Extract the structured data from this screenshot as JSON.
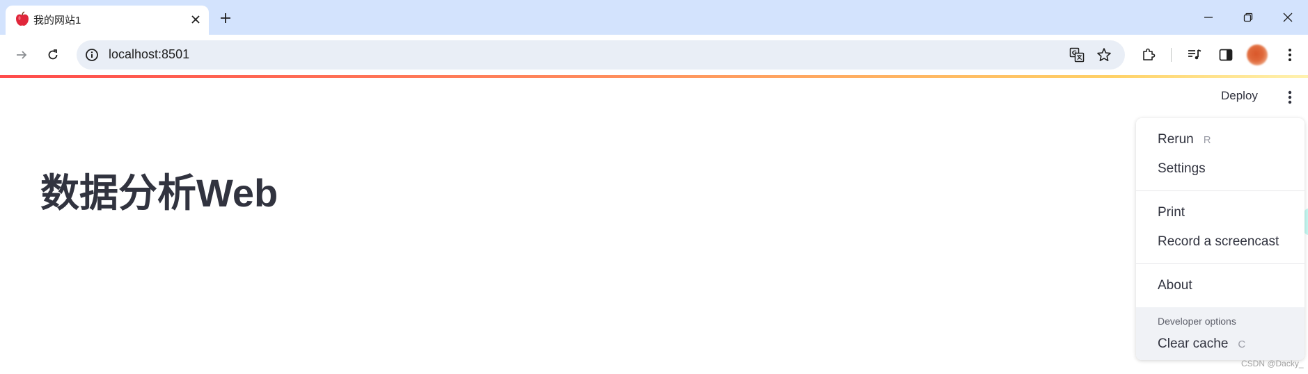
{
  "browser": {
    "tab": {
      "title": "我的网站1",
      "favicon": "apple-icon"
    },
    "address": {
      "url": "localhost:8501"
    }
  },
  "app": {
    "header": {
      "deploy_label": "Deploy"
    },
    "title": "数据分析Web"
  },
  "menu": {
    "items": [
      {
        "label": "Rerun",
        "shortcut": "R"
      },
      {
        "label": "Settings"
      },
      {
        "label": "Print"
      },
      {
        "label": "Record a screencast"
      },
      {
        "label": "About"
      }
    ],
    "developer": {
      "section_label": "Developer options",
      "items": [
        {
          "label": "Clear cache",
          "shortcut": "C"
        }
      ]
    }
  },
  "watermark": "CSDN @Dacky_",
  "colors": {
    "tabstrip": "#d3e3fd",
    "omnibox": "#e9eef6",
    "text": "#31333f",
    "accent_start": "#ff4b4b",
    "accent_end": "#fff2b0"
  }
}
